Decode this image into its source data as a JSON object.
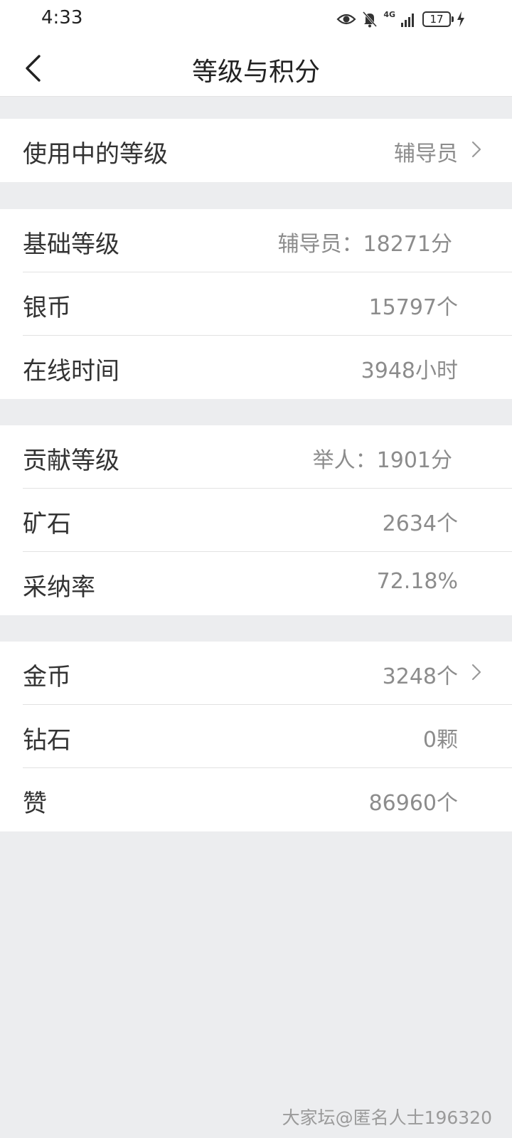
{
  "status_bar": {
    "time": "4:33",
    "network": "4G",
    "battery": "17"
  },
  "header": {
    "title": "等级与积分"
  },
  "current_level": {
    "label": "使用中的等级",
    "value": "辅导员"
  },
  "basic_section": [
    {
      "label": "基础等级",
      "value": "辅导员：18271分"
    },
    {
      "label": "银币",
      "value": "15797个"
    },
    {
      "label": "在线时间",
      "value": "3948小时"
    }
  ],
  "contribution_section": [
    {
      "label": "贡献等级",
      "value": "举人：1901分"
    },
    {
      "label": "矿石",
      "value": "2634个"
    },
    {
      "label": "采纳率",
      "value": "72.18%"
    }
  ],
  "assets_section": [
    {
      "label": "金币",
      "value": "3248个"
    },
    {
      "label": "钻石",
      "value": "0颗"
    },
    {
      "label": "赞",
      "value": "86960个"
    }
  ],
  "watermark": "大家坛@匿名人士196320",
  "colors": {
    "background": "#ecedef",
    "card": "#ffffff",
    "text_primary": "#333333",
    "text_secondary": "#8c8c8c"
  }
}
